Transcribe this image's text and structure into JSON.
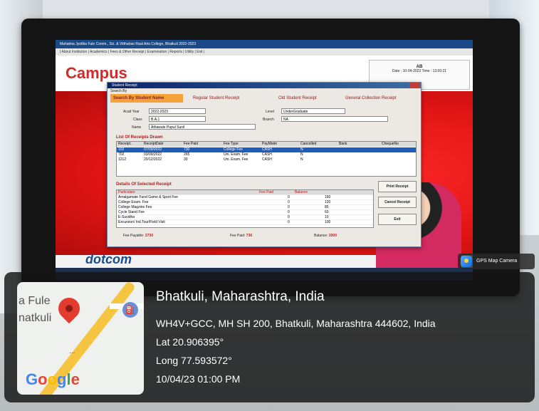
{
  "screen": {
    "app_title": "Mahatma Jyotiba Fule Comm., Sci. & Vitthalrao Raut Arts College, Bhatkuli 2022-2023",
    "menu": "| About Institution | Academics | Fees & Other Receipt | Examination | Reports | Utility | Exit |",
    "brand": "Campus",
    "user": "AB",
    "datetime": "Date : 10-04-2023  Time : 13:00:21",
    "footer_brand": "dotcom"
  },
  "dialog": {
    "title": "Student Receipt",
    "search_by": "Search By",
    "tab_active": "Search By Student Name",
    "radios": [
      "Regular Student Receipt",
      "Old Student Receipt",
      "General Collection Receipt"
    ],
    "acad_year_label": "Acad Year",
    "acad_year": "2022-2023",
    "class_label": "Class",
    "class": "B.A.1",
    "name_label": "Name",
    "name": "Athawale Papul Sunil",
    "level_label": "Level",
    "level": "UnderGraduate",
    "branch_label": "Branch",
    "branch": "NA",
    "receipts_title": "List Of Receipts Drawn",
    "receipts_headers": [
      "Receipt..",
      "ReceiptDate",
      "Fee Paid",
      "Fee Type",
      "PayMode",
      "Cancelled",
      "Bank",
      "ChequeNo"
    ],
    "receipts": [
      [
        "102",
        "07/09/2022",
        "730",
        "College Fee",
        "CASH",
        "N",
        "",
        ""
      ],
      [
        "702",
        "03/09/2022",
        "265",
        "Uni. Exam. Fee",
        "CASH",
        "N",
        "",
        ""
      ],
      [
        "1212",
        "20/12/2022",
        "30",
        "Uni. Exam. Fee",
        "CASH",
        "N",
        "",
        ""
      ]
    ],
    "details_title": "Details Of Selected Receipt",
    "details_headers": [
      "Particulars",
      "Fee Paid",
      "Balance"
    ],
    "details": [
      [
        "Amalgamate Fund Game & Sport Fee",
        "0",
        "160"
      ],
      [
        "College Exam. Fee",
        "0",
        "120"
      ],
      [
        "College Magzine Fee",
        "0",
        "85"
      ],
      [
        "Cycle Stand Fee",
        "0",
        "60"
      ],
      [
        "E-Suvidha",
        "0",
        "10"
      ],
      [
        "Excursion/ Ind.Tour/Field Visit",
        "0",
        "100"
      ]
    ],
    "buttons": [
      "Print Receipt",
      "Cancel Receipt",
      "Exit"
    ],
    "fee_payable_label": "Fee Payable:",
    "fee_payable": "2730",
    "fee_paid_label": "Fee Paid:",
    "fee_paid": "730",
    "balance_label": "Balance:",
    "balance": "2000"
  },
  "gps_badge": "GPS Map Camera",
  "overlay": {
    "place": "Bhatkuli, Maharashtra, India",
    "address": "WH4V+GCC, MH SH 200, Bhatkuli, Maharashtra 444602, India",
    "lat": "Lat 20.906395°",
    "long": "Long 77.593572°",
    "timestamp": "10/04/23 01:00 PM",
    "map_label_1": "a Fule",
    "map_label_2": "natkuli",
    "map_dots": "...",
    "map_logo": "Google"
  }
}
